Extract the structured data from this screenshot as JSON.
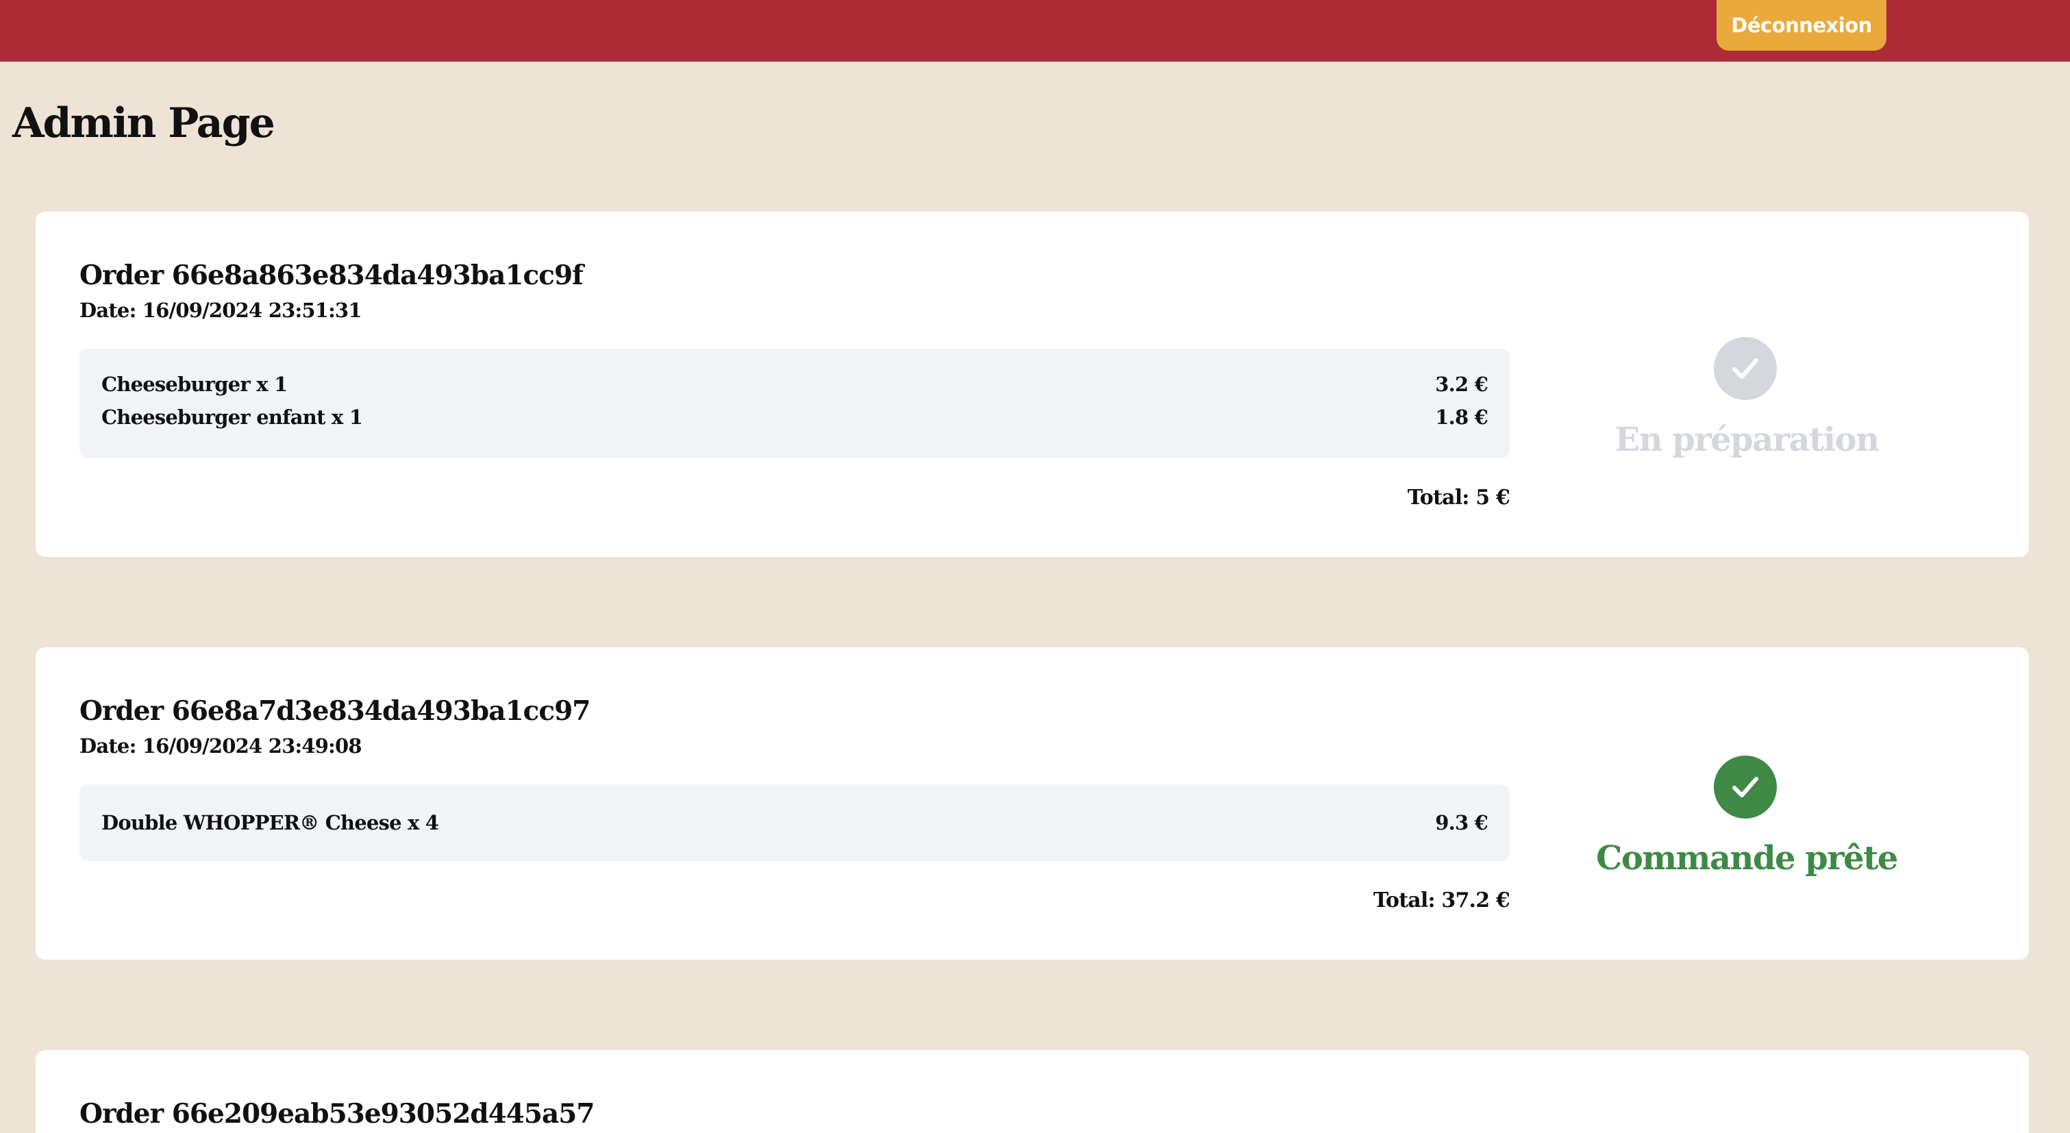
{
  "header": {
    "logout_label": "Déconnexion",
    "bar_color": "#ad2b37",
    "button_color": "#e9a93c"
  },
  "page": {
    "title": "Admin Page",
    "background": "#ede4d6"
  },
  "orders": [
    {
      "title": "Order 66e8a863e834da493ba1cc9f",
      "date": "Date: 16/09/2024 23:51:31",
      "items": [
        {
          "name": "Cheeseburger x 1",
          "price": "3.2 €"
        },
        {
          "name": "Cheeseburger enfant x 1",
          "price": "1.8 €"
        }
      ],
      "total": "Total: 5 €",
      "status": {
        "label": "En préparation",
        "icon": "check-circle-icon",
        "color": "#d4d8dd"
      }
    },
    {
      "title": "Order 66e8a7d3e834da493ba1cc97",
      "date": "Date: 16/09/2024 23:49:08",
      "items": [
        {
          "name": "Double WHOPPER® Cheese x 4",
          "price": "9.3 €"
        }
      ],
      "total": "Total: 37.2 €",
      "status": {
        "label": "Commande prête",
        "icon": "check-circle-icon",
        "color": "#3e8a45"
      }
    },
    {
      "title": "Order 66e209eab53e93052d445a57"
    }
  ]
}
